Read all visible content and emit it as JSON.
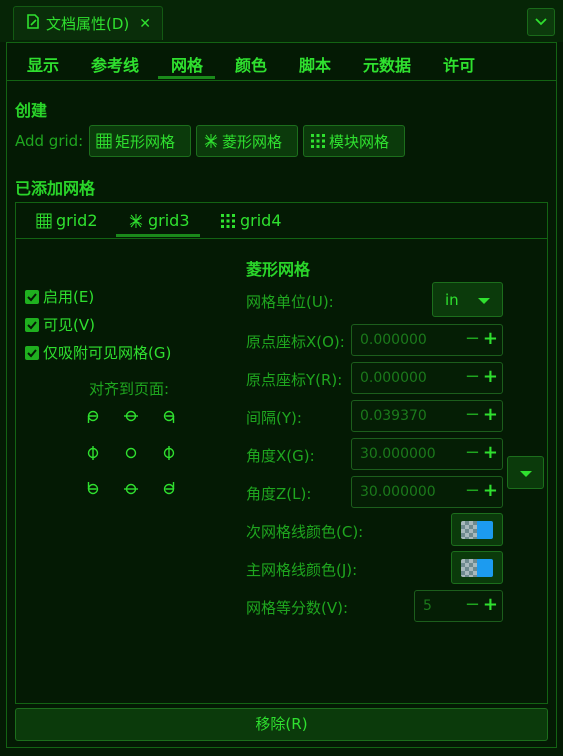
{
  "window": {
    "tab_title": "文档属性(D)",
    "close_glyph": "✕"
  },
  "tabs": [
    "显示",
    "参考线",
    "网格",
    "颜色",
    "脚本",
    "元数据",
    "许可"
  ],
  "active_tab": "网格",
  "create": {
    "heading": "创建",
    "add_label": "Add grid:",
    "buttons": [
      "矩形网格",
      "菱形网格",
      "模块网格"
    ]
  },
  "added": {
    "heading": "已添加网格",
    "grids": [
      "grid2",
      "grid3",
      "grid4"
    ],
    "active_grid": "grid3"
  },
  "options": {
    "enabled": "启用(E)",
    "visible": "可见(V)",
    "snap_visible": "仅吸附可见网格(G)",
    "align_label": "对齐到页面:"
  },
  "form": {
    "title": "菱形网格",
    "unit_label": "网格单位(U):",
    "unit_value": "in",
    "origin_x_label": "原点座标X(O):",
    "origin_x": "0.000000",
    "origin_y_label": "原点座标Y(R):",
    "origin_y": "0.000000",
    "spacing_label": "间隔(Y):",
    "spacing": "0.039370",
    "angle_x_label": "角度X(G):",
    "angle_x": "30.000000",
    "angle_z_label": "角度Z(L):",
    "angle_z": "30.000000",
    "minor_color_label": "次网格线颜色(C):",
    "major_color_label": "主网格线颜色(J):",
    "divisions_label": "网格等分数(V):",
    "divisions": "5",
    "minus": "−",
    "plus": "+"
  },
  "remove_label": "移除(R)",
  "colors": {
    "accent": "#2fe02f",
    "background": "#041a04",
    "swatch": "#1c9bf0"
  }
}
